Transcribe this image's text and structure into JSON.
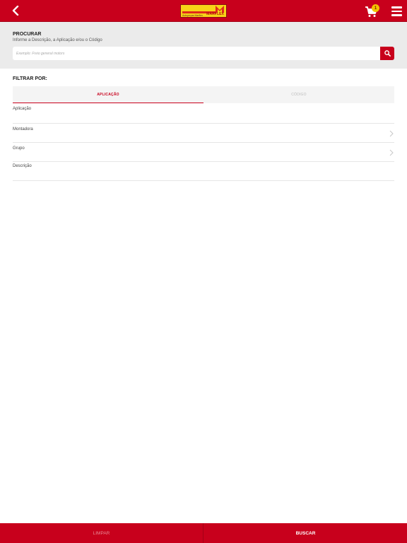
{
  "header": {
    "logo_word": "MARFLEX",
    "logo_tag": "Autopeças Marflex",
    "cart_count": "1"
  },
  "search": {
    "title": "PROCURAR",
    "subtitle": "Informe a Descrição, a Aplicação e/ou o Código",
    "placeholder": "Exemplo: Freio general motors"
  },
  "filter": {
    "label": "FILTRAR POR:",
    "tabs": [
      {
        "label": "APLICAÇÃO",
        "active": true
      },
      {
        "label": "CÓDIGO",
        "active": false
      }
    ],
    "fields": [
      {
        "label": "Aplicação",
        "has_chevron": false
      },
      {
        "label": "Montadora",
        "has_chevron": true
      },
      {
        "label": "Grupo",
        "has_chevron": true
      },
      {
        "label": "Descrição",
        "has_chevron": false
      }
    ]
  },
  "footer": {
    "clear_label": "LIMPAR",
    "search_label": "BUSCAR"
  },
  "colors": {
    "brand_red": "#c8001c",
    "logo_yellow": "#f7d417",
    "badge_yellow": "#f2c300"
  }
}
